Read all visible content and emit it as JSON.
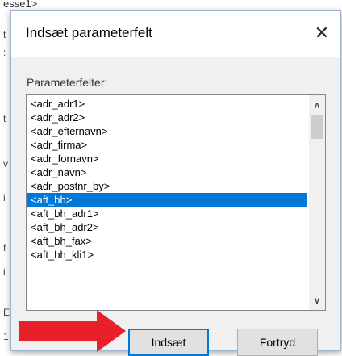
{
  "background": {
    "fragments": [
      "esse1>",
      "t",
      ":",
      "t",
      "v",
      "i",
      "f",
      "i",
      "E",
      "1"
    ]
  },
  "dialog": {
    "title": "Indsæt parameterfelt",
    "close_glyph": "✕",
    "list_label": "Parameterfelter:",
    "items": [
      "<adr_adr1>",
      "<adr_adr2>",
      "<adr_efternavn>",
      "<adr_firma>",
      "<adr_fornavn>",
      "<adr_navn>",
      "<adr_postnr_by>",
      "<aft_bh>",
      "<aft_bh_adr1>",
      "<aft_bh_adr2>",
      "<aft_bh_fax>",
      "<aft_bh_kli1>"
    ],
    "selected_item": "<aft_bh>",
    "scroll_up_glyph": "∧",
    "scroll_down_glyph": "∨",
    "buttons": {
      "insert": "Indsæt",
      "cancel": "Fortryd"
    }
  },
  "colors": {
    "selection": "#0078d7",
    "arrow": "#e8202a",
    "dialog_border": "#9ab3d1"
  },
  "icons": {
    "close": "close-icon",
    "scroll_up": "chevron-up-icon",
    "scroll_down": "chevron-down-icon",
    "annotation_arrow": "red-arrow-icon"
  }
}
